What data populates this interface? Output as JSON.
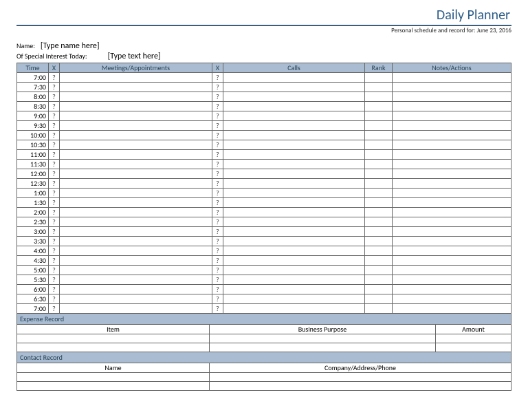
{
  "header": {
    "title": "Daily Planner",
    "subtitle": "Personal schedule and record for: June 23, 2016"
  },
  "meta": {
    "name_label": "Name:",
    "name_value": "[Type name here]",
    "interest_label": "Of Special Interest Today:",
    "interest_value": "[Type text here]"
  },
  "schedule": {
    "headers": {
      "time": "Time",
      "x1": "X",
      "meetings": "Meetings/Appointments",
      "x2": "X",
      "calls": "Calls",
      "rank": "Rank",
      "notes": "Notes/Actions"
    },
    "rows": [
      {
        "time": "7:00",
        "x1": "?",
        "meet": "",
        "x2": "?",
        "calls": "",
        "rank": "",
        "notes": ""
      },
      {
        "time": "7:30",
        "x1": "?",
        "meet": "",
        "x2": "?",
        "calls": "",
        "rank": "",
        "notes": ""
      },
      {
        "time": "8:00",
        "x1": "?",
        "meet": "",
        "x2": "?",
        "calls": "",
        "rank": "",
        "notes": ""
      },
      {
        "time": "8:30",
        "x1": "?",
        "meet": "",
        "x2": "?",
        "calls": "",
        "rank": "",
        "notes": ""
      },
      {
        "time": "9:00",
        "x1": "?",
        "meet": "",
        "x2": "?",
        "calls": "",
        "rank": "",
        "notes": ""
      },
      {
        "time": "9:30",
        "x1": "?",
        "meet": "",
        "x2": "?",
        "calls": "",
        "rank": "",
        "notes": ""
      },
      {
        "time": "10:00",
        "x1": "?",
        "meet": "",
        "x2": "?",
        "calls": "",
        "rank": "",
        "notes": ""
      },
      {
        "time": "10:30",
        "x1": "?",
        "meet": "",
        "x2": "?",
        "calls": "",
        "rank": "",
        "notes": ""
      },
      {
        "time": "11:00",
        "x1": "?",
        "meet": "",
        "x2": "?",
        "calls": "",
        "rank": "",
        "notes": ""
      },
      {
        "time": "11:30",
        "x1": "?",
        "meet": "",
        "x2": "?",
        "calls": "",
        "rank": "",
        "notes": ""
      },
      {
        "time": "12:00",
        "x1": "?",
        "meet": "",
        "x2": "?",
        "calls": "",
        "rank": "",
        "notes": ""
      },
      {
        "time": "12:30",
        "x1": "?",
        "meet": "",
        "x2": "?",
        "calls": "",
        "rank": "",
        "notes": ""
      },
      {
        "time": "1:00",
        "x1": "?",
        "meet": "",
        "x2": "?",
        "calls": "",
        "rank": "",
        "notes": ""
      },
      {
        "time": "1:30",
        "x1": "?",
        "meet": "",
        "x2": "?",
        "calls": "",
        "rank": "",
        "notes": ""
      },
      {
        "time": "2:00",
        "x1": "?",
        "meet": "",
        "x2": "?",
        "calls": "",
        "rank": "",
        "notes": ""
      },
      {
        "time": "2:30",
        "x1": "?",
        "meet": "",
        "x2": "?",
        "calls": "",
        "rank": "",
        "notes": ""
      },
      {
        "time": "3:00",
        "x1": "?",
        "meet": "",
        "x2": "?",
        "calls": "",
        "rank": "",
        "notes": ""
      },
      {
        "time": "3:30",
        "x1": "?",
        "meet": "",
        "x2": "?",
        "calls": "",
        "rank": "",
        "notes": ""
      },
      {
        "time": "4:00",
        "x1": "?",
        "meet": "",
        "x2": "?",
        "calls": "",
        "rank": "",
        "notes": ""
      },
      {
        "time": "4:30",
        "x1": "?",
        "meet": "",
        "x2": "?",
        "calls": "",
        "rank": "",
        "notes": ""
      },
      {
        "time": "5:00",
        "x1": "?",
        "meet": "",
        "x2": "?",
        "calls": "",
        "rank": "",
        "notes": ""
      },
      {
        "time": "5:30",
        "x1": "?",
        "meet": "",
        "x2": "?",
        "calls": "",
        "rank": "",
        "notes": ""
      },
      {
        "time": "6:00",
        "x1": "?",
        "meet": "",
        "x2": "?",
        "calls": "",
        "rank": "",
        "notes": ""
      },
      {
        "time": "6:30",
        "x1": "?",
        "meet": "",
        "x2": "?",
        "calls": "",
        "rank": "",
        "notes": ""
      },
      {
        "time": "7:00",
        "x1": "?",
        "meet": "",
        "x2": "?",
        "calls": "",
        "rank": "",
        "notes": ""
      }
    ]
  },
  "expense": {
    "title": "Expense Record",
    "headers": {
      "item": "Item",
      "purpose": "Business Purpose",
      "amount": "Amount"
    },
    "rows": [
      {
        "item": "",
        "purpose": "",
        "amount": ""
      },
      {
        "item": "",
        "purpose": "",
        "amount": ""
      }
    ]
  },
  "contact": {
    "title": "Contact Record",
    "headers": {
      "name": "Name",
      "company": "Company/Address/Phone"
    },
    "rows": [
      {
        "name": "",
        "company": ""
      },
      {
        "name": "",
        "company": ""
      }
    ]
  }
}
